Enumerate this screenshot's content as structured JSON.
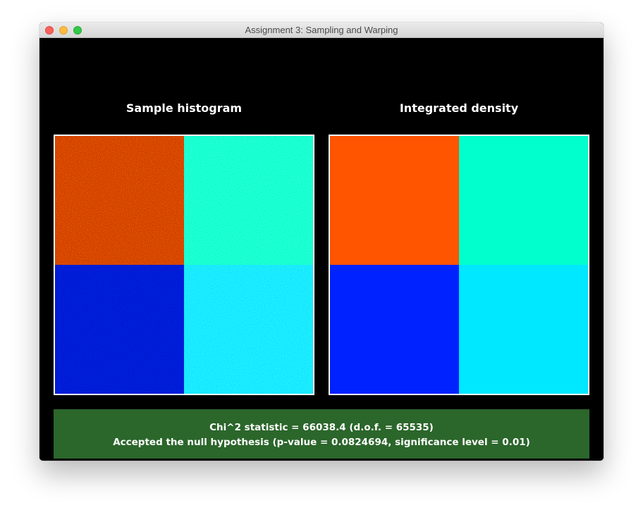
{
  "window": {
    "title": "Assignment 3: Sampling and Warping"
  },
  "panels": {
    "left_title": "Sample histogram",
    "right_title": "Integrated density"
  },
  "result": {
    "line1": "Chi^2 statistic = 66038.4 (d.o.f. = 65535)",
    "line2": "Accepted the null hypothesis (p-value = 0.0824694, significance level = 0.01)",
    "status_color": "#2b662b"
  },
  "quadrant_colors": {
    "top_left": "#ff5500",
    "top_right": "#00ffcc",
    "bottom_left": "#0022ff",
    "bottom_right": "#00e8ff"
  },
  "icons": {
    "close": "close-traffic-light-icon",
    "minimize": "minimize-traffic-light-icon",
    "maximize": "maximize-traffic-light-icon"
  }
}
